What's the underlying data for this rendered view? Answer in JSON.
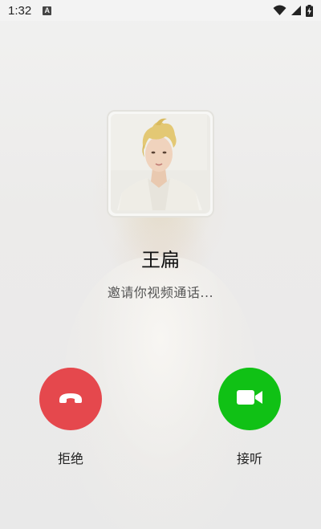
{
  "status_bar": {
    "time": "1:32",
    "notification_icon": "a-icon",
    "icons": [
      "wifi-icon",
      "signal-icon",
      "battery-charging-icon"
    ]
  },
  "call": {
    "caller_name": "王扁",
    "status_text": "邀请你视频通话...",
    "avatar_icon": "avatar"
  },
  "actions": {
    "decline_label": "拒绝",
    "accept_label": "接听",
    "decline_color": "#e5484d",
    "accept_color": "#10c115"
  }
}
